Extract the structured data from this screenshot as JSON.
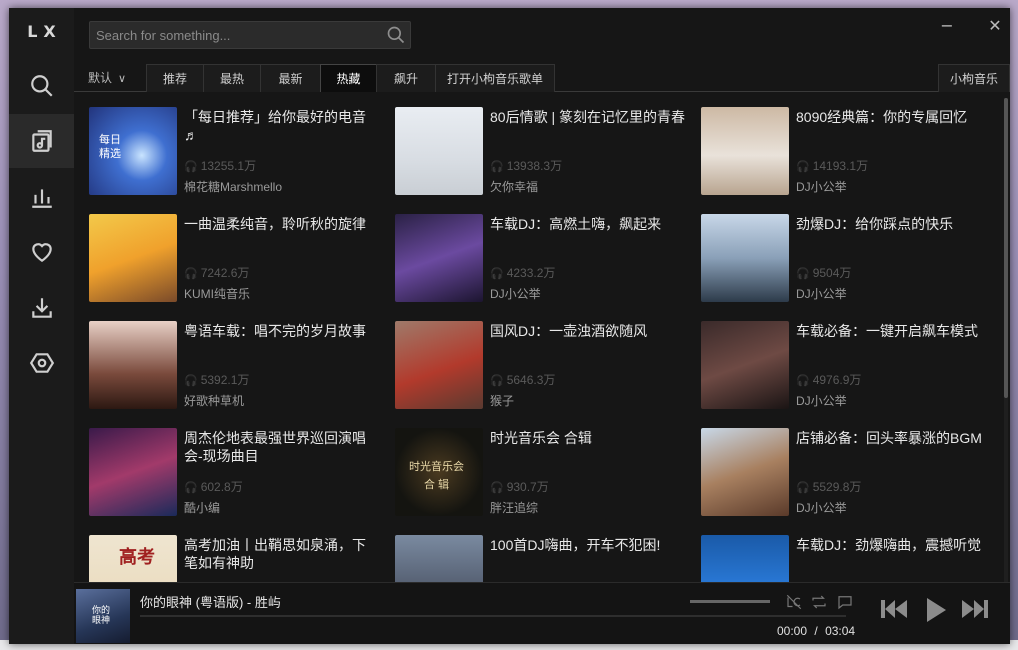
{
  "app": {
    "logo": "LX"
  },
  "sidebar": {
    "items": [
      {
        "name": "search",
        "active": false
      },
      {
        "name": "songlist",
        "active": true
      },
      {
        "name": "charts",
        "active": false
      },
      {
        "name": "favorites",
        "active": false
      },
      {
        "name": "download",
        "active": false
      },
      {
        "name": "settings",
        "active": false
      }
    ]
  },
  "search": {
    "placeholder": "Search for something..."
  },
  "window_controls": {
    "minimize": "−",
    "close": "✕"
  },
  "tabs": {
    "sort_label": "默认",
    "items": [
      "推荐",
      "最热",
      "最新",
      "热藏",
      "飙升",
      "打开小枸音乐歌单"
    ],
    "active": "热藏",
    "source": "小枸音乐"
  },
  "playlists": [
    {
      "title": "「每日推荐」给你最好的电音♬",
      "plays": "13255.1万",
      "author": "棉花糖Marshmello",
      "cover_text": "每日\n精选"
    },
    {
      "title": "80后情歌 | 篆刻在记忆里的青春",
      "plays": "13938.3万",
      "author": "欠你幸福",
      "cover_text": ""
    },
    {
      "title": "8090经典篇：你的专属回忆",
      "plays": "14193.1万",
      "author": "DJ小公举",
      "cover_text": ""
    },
    {
      "title": "一曲温柔纯音，聆听秋的旋律",
      "plays": "7242.6万",
      "author": "KUMI纯音乐",
      "cover_text": ""
    },
    {
      "title": "车载DJ：高燃土嗨，飙起来",
      "plays": "4233.2万",
      "author": "DJ小公举",
      "cover_text": ""
    },
    {
      "title": "劲爆DJ：给你踩点的快乐",
      "plays": "9504万",
      "author": "DJ小公举",
      "cover_text": ""
    },
    {
      "title": "粤语车载：唱不完的岁月故事",
      "plays": "5392.1万",
      "author": "好歌种草机",
      "cover_text": ""
    },
    {
      "title": "国风DJ：一壶浊酒欲随风",
      "plays": "5646.3万",
      "author": "猴子",
      "cover_text": ""
    },
    {
      "title": "车载必备：一键开启飙车模式",
      "plays": "4976.9万",
      "author": "DJ小公举",
      "cover_text": ""
    },
    {
      "title": "周杰伦地表最强世界巡回演唱会-现场曲目",
      "plays": "602.8万",
      "author": "酷小编",
      "cover_text": ""
    },
    {
      "title": "时光音乐会 合辑",
      "plays": "930.7万",
      "author": "胖汪追综",
      "cover_text": "时光音乐会\n合 辑"
    },
    {
      "title": "店铺必备：回头率暴涨的BGM",
      "plays": "5529.8万",
      "author": "DJ小公举",
      "cover_text": ""
    },
    {
      "title": "高考加油丨出鞘思如泉涌，下笔如有神助",
      "plays": "",
      "author": "",
      "cover_text": "高考"
    },
    {
      "title": "100首DJ嗨曲，开车不犯困!",
      "plays": "",
      "author": "",
      "cover_text": ""
    },
    {
      "title": "车载DJ：劲爆嗨曲，震撼听觉",
      "plays": "",
      "author": "",
      "cover_text": ""
    }
  ],
  "player": {
    "track": "你的眼神 (粤语版) - 胜屿",
    "current_time": "00:00",
    "separator": "/",
    "duration": "03:04",
    "cover_text": "你的\n眼神"
  },
  "colors": {
    "window_bg": "#161616",
    "sidebar_bg": "#1b1b1b",
    "active_tab_bg": "#0d0d0d",
    "muted_text": "#5a5a5a"
  }
}
